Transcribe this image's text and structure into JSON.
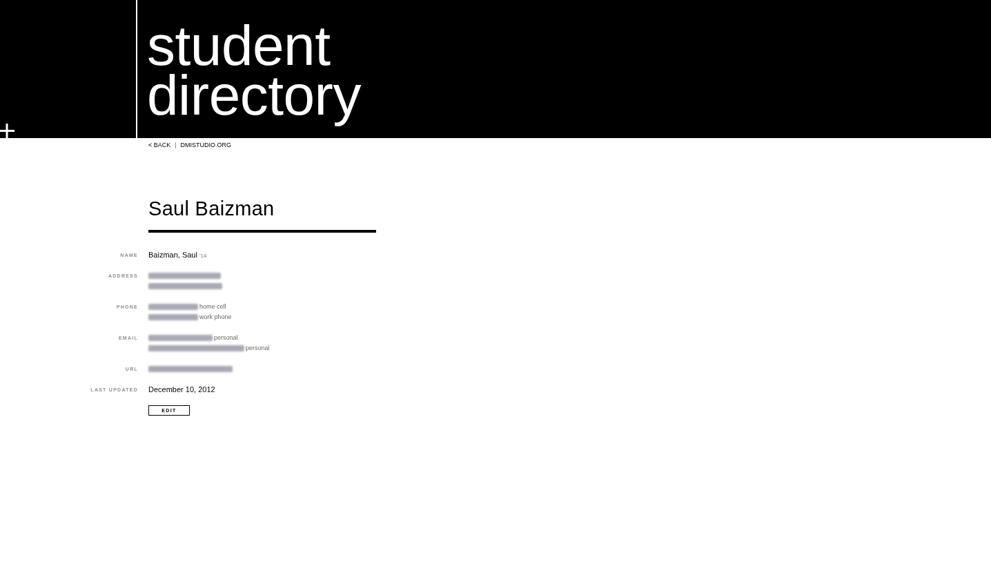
{
  "header": {
    "title_lines": [
      "student",
      "directory"
    ]
  },
  "nav": {
    "links": [
      "< BACK",
      "DMISTUDIO.ORG"
    ],
    "separator": "|"
  },
  "profile": {
    "name": "Saul Baizman",
    "fields": [
      {
        "label": "NAME",
        "lines": [
          {
            "kind": "text",
            "value": "Baizman, Saul",
            "note": "'14"
          }
        ]
      },
      {
        "label": "ADDRESS",
        "lines": [
          {
            "kind": "redacted"
          },
          {
            "kind": "redacted"
          }
        ]
      },
      {
        "label": "PHONE",
        "lines": [
          {
            "kind": "redacted",
            "note": "home cell"
          },
          {
            "kind": "redacted",
            "note": "work phone"
          }
        ]
      },
      {
        "label": "EMAIL",
        "lines": [
          {
            "kind": "redacted",
            "note": "personal"
          },
          {
            "kind": "redacted",
            "note": "personal"
          }
        ]
      },
      {
        "label": "URL",
        "lines": [
          {
            "kind": "redacted"
          }
        ]
      },
      {
        "label": "LAST UPDATED",
        "lines": [
          {
            "kind": "text",
            "value": "December 10, 2012"
          }
        ]
      }
    ],
    "edit_button": "EDIT"
  }
}
